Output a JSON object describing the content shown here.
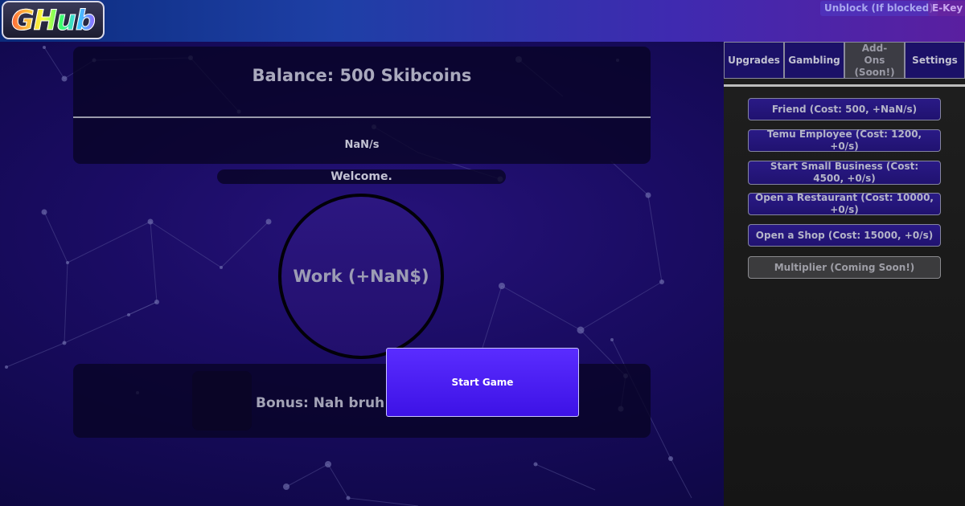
{
  "header": {
    "logo_text": "GHub",
    "links": [
      "Unblock (If blocked)",
      "E-Key"
    ]
  },
  "main": {
    "balance": "Balance: 500 Skibcoins",
    "rate": "NaN/s",
    "welcome": "Welcome.",
    "work_button": "Work (+NaN$)",
    "bonus": "Bonus: Nah bruh I",
    "start_button": "Start Game"
  },
  "sidebar": {
    "tabs": [
      {
        "label": "Upgrades"
      },
      {
        "label": "Gambling"
      },
      {
        "label": "Add-Ons (Soon!)"
      },
      {
        "label": "Settings"
      }
    ],
    "upgrades": [
      {
        "label": "Friend (Cost: 500, +NaN/s)"
      },
      {
        "label": "Temu Employee (Cost: 1200, +0/s)"
      },
      {
        "label": "Start Small Business (Cost: 4500, +0/s)"
      },
      {
        "label": "Open a Restaurant (Cost: 10000, +0/s)"
      },
      {
        "label": "Open a Shop (Cost: 15000, +0/s)"
      },
      {
        "label": "Multiplier (Coming Soon!)"
      }
    ]
  },
  "colors": {
    "accent": "#4a1ff5",
    "background": "#1a0c63",
    "sidebar": "#1b1b1b"
  }
}
